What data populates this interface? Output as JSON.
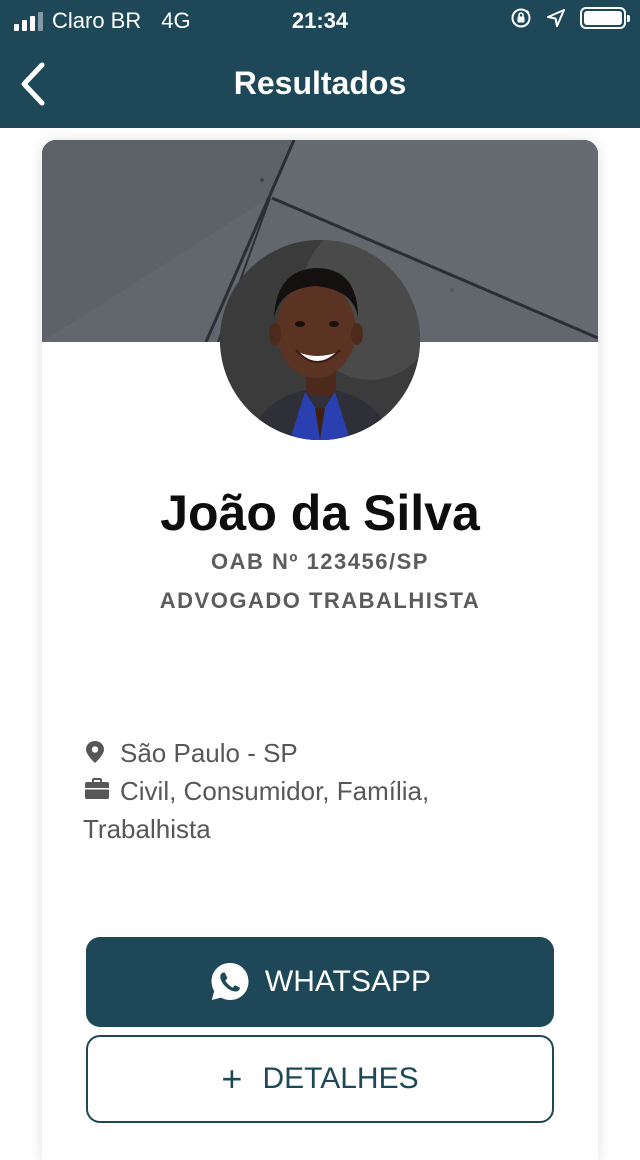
{
  "status_bar": {
    "carrier": "Claro BR",
    "network": "4G",
    "time": "21:34"
  },
  "nav": {
    "title": "Resultados",
    "back_icon": "chevron-left-icon"
  },
  "profile": {
    "name": "João da Silva",
    "oab": "OAB Nº 123456/SP",
    "specialty": "ADVOGADO TRABALHISTA",
    "location": "São Paulo - SP",
    "practice_areas_line1": "Civil, Consumidor, Família,",
    "practice_areas_line2": "Trabalhista"
  },
  "actions": {
    "whatsapp_label": "WHATSAPP",
    "details_plus": "+",
    "details_label": "DETALHES"
  },
  "colors": {
    "brand": "#1e4858",
    "cover": "#62676d",
    "text_muted": "#5c5c5c"
  }
}
